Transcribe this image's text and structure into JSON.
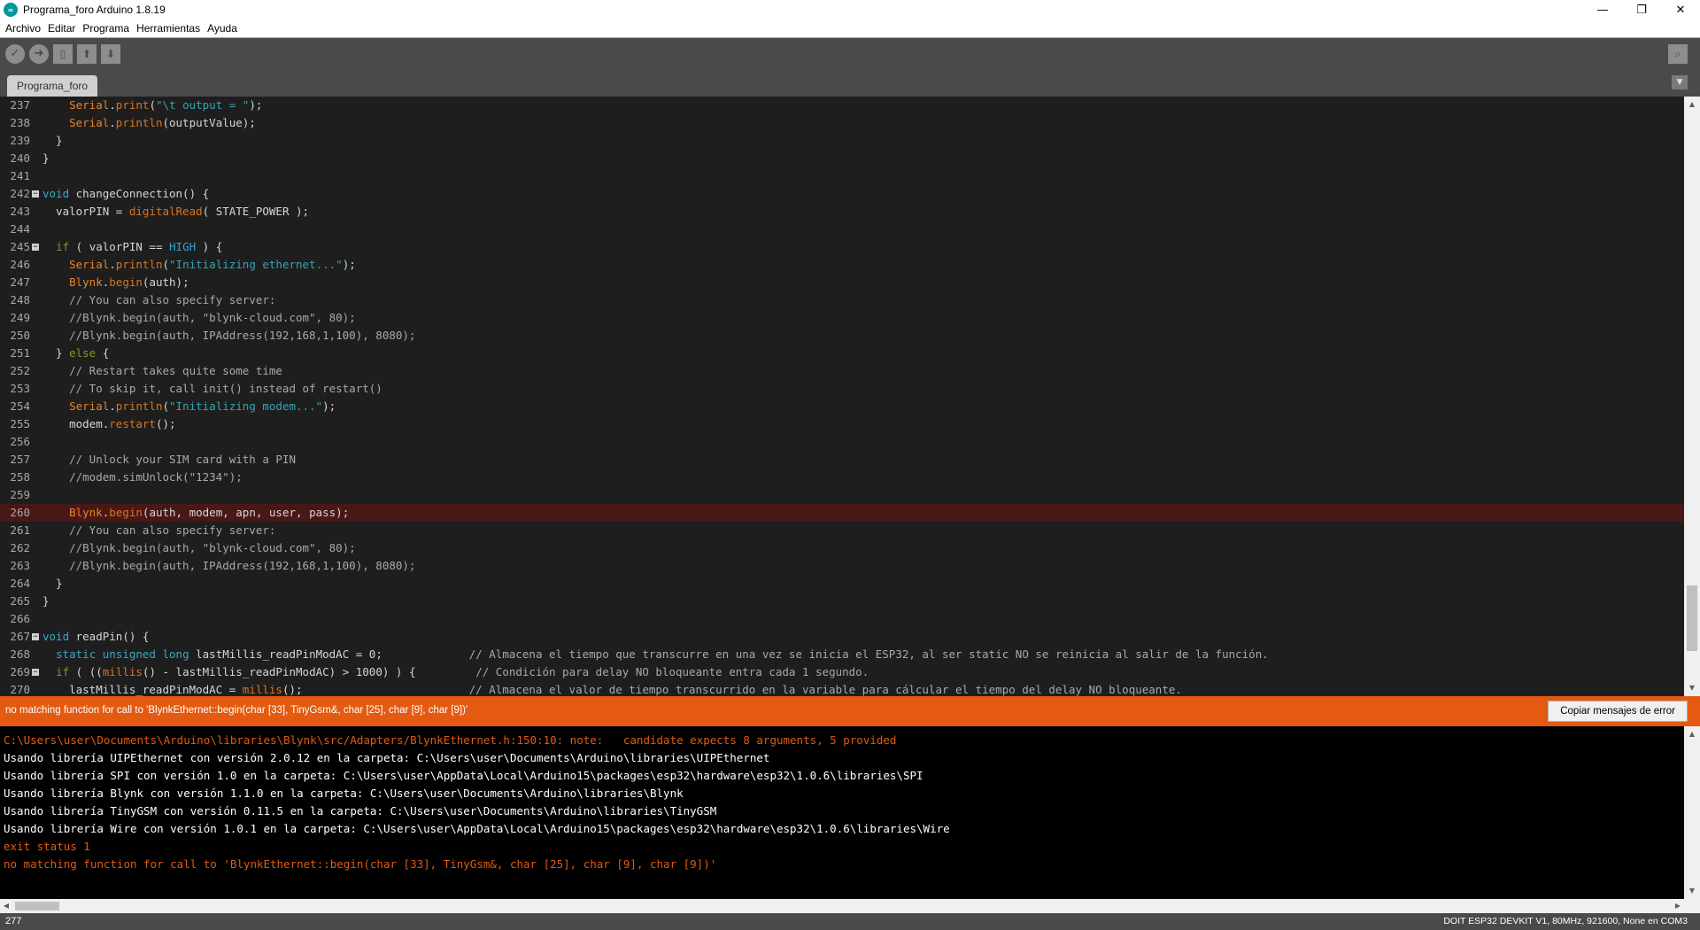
{
  "window": {
    "title": "Programa_foro Arduino 1.8.19",
    "app_icon": "arduino-logo-icon",
    "controls": [
      "—",
      "❐",
      "✕"
    ]
  },
  "menu": [
    "Archivo",
    "Editar",
    "Programa",
    "Herramientas",
    "Ayuda"
  ],
  "toolbar": {
    "verify_icon": "check-icon",
    "upload_icon": "arrow-right-icon",
    "new_icon": "new-file-icon",
    "open_icon": "arrow-up-icon",
    "save_icon": "arrow-down-icon",
    "serial_monitor_icon": "magnifier-icon"
  },
  "tabs": [
    {
      "label": "Programa_foro"
    }
  ],
  "editor": {
    "highlighted_line": 260,
    "lines": [
      {
        "n": "237",
        "fold": false,
        "html": "    <span class=\"kw-class\">Serial</span>.<span class=\"kw-fn\">print</span>(<span class=\"str\">\"\\t output = \"</span>);"
      },
      {
        "n": "238",
        "fold": false,
        "html": "    <span class=\"kw-class\">Serial</span>.<span class=\"kw-fn\">println</span>(outputValue);"
      },
      {
        "n": "239",
        "fold": false,
        "html": "  }"
      },
      {
        "n": "240",
        "fold": false,
        "html": "}"
      },
      {
        "n": "241",
        "fold": false,
        "html": ""
      },
      {
        "n": "242",
        "fold": true,
        "html": "<span class=\"kw-type\">void</span> changeConnection() {"
      },
      {
        "n": "243",
        "fold": false,
        "html": "  valorPIN = <span class=\"kw-fn\">digitalRead</span>( STATE_POWER );"
      },
      {
        "n": "244",
        "fold": false,
        "html": ""
      },
      {
        "n": "245",
        "fold": true,
        "html": "  <span class=\"kw-ctl\">if</span> ( valorPIN == <span class=\"kw-const\">HIGH</span> ) {"
      },
      {
        "n": "246",
        "fold": false,
        "html": "    <span class=\"kw-class\">Serial</span>.<span class=\"kw-fn\">println</span>(<span class=\"str\">\"Initializing ethernet...\"</span>);"
      },
      {
        "n": "247",
        "fold": false,
        "html": "    <span class=\"kw-class\">Blynk</span>.<span class=\"kw-fn\">begin</span>(auth);"
      },
      {
        "n": "248",
        "fold": false,
        "html": "    <span class=\"cmt\">// You can also specify server:</span>"
      },
      {
        "n": "249",
        "fold": false,
        "html": "    <span class=\"cmt\">//Blynk.begin(auth, \"blynk-cloud.com\", 80);</span>"
      },
      {
        "n": "250",
        "fold": false,
        "html": "    <span class=\"cmt\">//Blynk.begin(auth, IPAddress(192,168,1,100), 8080);</span>"
      },
      {
        "n": "251",
        "fold": false,
        "html": "  } <span class=\"kw-ctl\">else</span> {"
      },
      {
        "n": "252",
        "fold": false,
        "html": "    <span class=\"cmt\">// Restart takes quite some time</span>"
      },
      {
        "n": "253",
        "fold": false,
        "html": "    <span class=\"cmt\">// To skip it, call init() instead of restart()</span>"
      },
      {
        "n": "254",
        "fold": false,
        "html": "    <span class=\"kw-class\">Serial</span>.<span class=\"kw-fn\">println</span>(<span class=\"str\">\"Initializing modem...\"</span>);"
      },
      {
        "n": "255",
        "fold": false,
        "html": "    modem.<span class=\"kw-fn\">restart</span>();"
      },
      {
        "n": "256",
        "fold": false,
        "html": ""
      },
      {
        "n": "257",
        "fold": false,
        "html": "    <span class=\"cmt\">// Unlock your SIM card with a PIN</span>"
      },
      {
        "n": "258",
        "fold": false,
        "html": "    <span class=\"cmt\">//modem.simUnlock(\"1234\");</span>"
      },
      {
        "n": "259",
        "fold": false,
        "html": ""
      },
      {
        "n": "260",
        "fold": false,
        "html": "    <span class=\"kw-class\">Blynk</span>.<span class=\"kw-fn\">begin</span>(auth, modem, apn, user, pass);"
      },
      {
        "n": "261",
        "fold": false,
        "html": "    <span class=\"cmt\">// You can also specify server:</span>"
      },
      {
        "n": "262",
        "fold": false,
        "html": "    <span class=\"cmt\">//Blynk.begin(auth, \"blynk-cloud.com\", 80);</span>"
      },
      {
        "n": "263",
        "fold": false,
        "html": "    <span class=\"cmt\">//Blynk.begin(auth, IPAddress(192,168,1,100), 8080);</span>"
      },
      {
        "n": "264",
        "fold": false,
        "html": "  }"
      },
      {
        "n": "265",
        "fold": false,
        "html": "}"
      },
      {
        "n": "266",
        "fold": false,
        "html": ""
      },
      {
        "n": "267",
        "fold": true,
        "html": "<span class=\"kw-type\">void</span> readPin() {"
      },
      {
        "n": "268",
        "fold": false,
        "html": "  <span class=\"kw-type\">static</span> <span class=\"kw-type\">unsigned</span> <span class=\"kw-type\">long</span> lastMillis_readPinModAC = 0;             <span class=\"cmt\">// Almacena el tiempo que transcurre en una vez se inicia el ESP32, al ser static NO se reinicia al salir de la función.</span>"
      },
      {
        "n": "269",
        "fold": true,
        "html": "  <span class=\"kw-ctl\">if</span> ( ((<span class=\"kw-fn\">millis</span>() - lastMillis_readPinModAC) > 1000) ) {         <span class=\"cmt\">// Condición para delay NO bloqueante entra cada 1 segundo.</span>"
      },
      {
        "n": "270",
        "fold": false,
        "html": "    lastMillis_readPinModAC = <span class=\"kw-fn\">millis</span>();                         <span class=\"cmt\">// Almacena el valor de tiempo transcurrido en la variable para cálcular el tiempo del delay NO bloqueante.</span>"
      }
    ]
  },
  "error_bar": {
    "message": "no matching function for call to 'BlynkEthernet::begin(char [33], TinyGsm&, char [25], char [9], char [9])'",
    "copy_button": "Copiar mensajes de error"
  },
  "console": {
    "lines": [
      {
        "text": "C:\\Users\\user\\Documents\\Arduino\\libraries\\Blynk\\src/Adapters/BlynkEthernet.h:150:10: note:   candidate expects 8 arguments, 5 provided",
        "error": true
      },
      {
        "text": "Usando librería UIPEthernet con versión 2.0.12 en la carpeta: C:\\Users\\user\\Documents\\Arduino\\libraries\\UIPEthernet",
        "error": false
      },
      {
        "text": "Usando librería SPI con versión 1.0 en la carpeta: C:\\Users\\user\\AppData\\Local\\Arduino15\\packages\\esp32\\hardware\\esp32\\1.0.6\\libraries\\SPI",
        "error": false
      },
      {
        "text": "Usando librería Blynk con versión 1.1.0 en la carpeta: C:\\Users\\user\\Documents\\Arduino\\libraries\\Blynk",
        "error": false
      },
      {
        "text": "Usando librería TinyGSM con versión 0.11.5 en la carpeta: C:\\Users\\user\\Documents\\Arduino\\libraries\\TinyGSM",
        "error": false
      },
      {
        "text": "Usando librería Wire con versión 1.0.1 en la carpeta: C:\\Users\\user\\AppData\\Local\\Arduino15\\packages\\esp32\\hardware\\esp32\\1.0.6\\libraries\\Wire",
        "error": false
      },
      {
        "text": "exit status 1",
        "error": true
      },
      {
        "text": "no matching function for call to 'BlynkEthernet::begin(char [33], TinyGsm&, char [25], char [9], char [9])'",
        "error": true
      }
    ]
  },
  "status": {
    "line_number": "277",
    "board": "DOIT ESP32 DEVKIT V1, 80MHz, 921600, None en COM3"
  },
  "colors": {
    "toolbar_bg": "#4a4a4a",
    "editor_bg": "#1e1e1e",
    "error_orange": "#e35a10",
    "highlight_line": "#4a1717"
  }
}
